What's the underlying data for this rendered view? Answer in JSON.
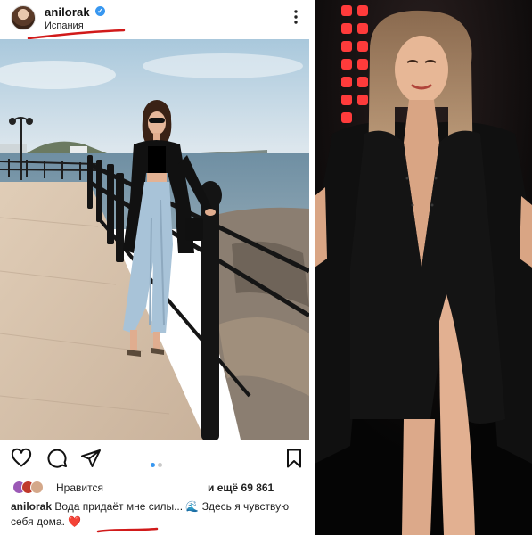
{
  "post": {
    "username": "anilorak",
    "verified_symbol": "✓",
    "location": "Испания",
    "carousel": {
      "total": 2,
      "active": 1
    },
    "likes": {
      "label": "Нравится",
      "count_text": "и ещё 69 861"
    },
    "caption": {
      "username": "anilorak",
      "text": "Вода придаёт мне силы...",
      "emoji_wave": "🌊",
      "text2": "Здесь я чувствую себя дома.",
      "emoji_heart": "❤️"
    },
    "icons": [
      "more-icon",
      "heart-icon",
      "comment-icon",
      "share-icon",
      "save-icon"
    ]
  },
  "colors": {
    "accent_blue": "#3897f0",
    "annotation_red": "#d11a1a",
    "stage_light_red": "#ff3b3b"
  }
}
